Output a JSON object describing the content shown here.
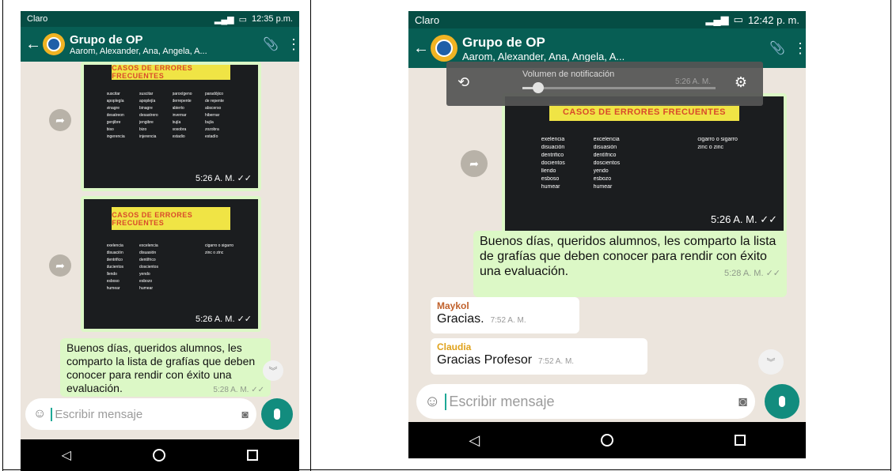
{
  "phones": [
    {
      "status": {
        "carrier": "Claro",
        "time": "12:35 p.m."
      },
      "header": {
        "title": "Grupo de OP",
        "members": "Aarom, Alexander, Ana, Angela, A..."
      },
      "images": [
        {
          "banner": "CASOS DE ERRORES FRECUENTES",
          "words": [
            "suscitar",
            "suscitar",
            "paroxígeno",
            "paradójico",
            "apoplegía",
            "apoplejía",
            "derrepente",
            "de repente",
            "vinagre",
            "binagre",
            "abierto",
            "abscerso",
            "desatreon",
            "desastrero",
            "invernar",
            "hibernar",
            "genjibre",
            "jengibre",
            "bujía",
            "bujía",
            "biso",
            "bizo",
            "sosobra",
            "zozobra",
            "ingerencia",
            "injerencia",
            "estadio",
            "estadío"
          ],
          "time": "5:26 A. M."
        },
        {
          "banner": "CASOS DE ERRORES FRECUENTES",
          "words": [
            "exelencia",
            "excelencia",
            "",
            "cigarro o sigarro",
            "disuación",
            "disuasión",
            "",
            "zinc o zinc",
            "dentrifico",
            "dentífrico",
            "",
            "",
            "ducientos",
            "doscientos",
            "",
            "",
            "llendo",
            "yendo",
            "",
            "",
            "esboso",
            "esbozo",
            "",
            "",
            "humear",
            "humear",
            "",
            ""
          ],
          "time": "5:26 A. M."
        }
      ],
      "message": {
        "text": "Buenos días, queridos alumnos, les comparto la lista de grafías que deben conocer para rendir con éxito una evaluación.",
        "time": "5:28 A. M."
      },
      "input": {
        "placeholder": "Escribir mensaje"
      }
    },
    {
      "status": {
        "carrier": "Claro",
        "time": "12:42 p. m."
      },
      "header": {
        "title": "Grupo de OP",
        "members": "Aarom, Alexander, Ana, Angela, A..."
      },
      "volume": {
        "label": "Volumen de notificación",
        "level": 0.08,
        "ghost_time": "5:26 A. M."
      },
      "image": {
        "banner": "CASOS DE ERRORES FRECUENTES",
        "words": [
          "exelencia",
          "excelencia",
          "",
          "cigarro o sigarro",
          "disuación",
          "disuasión",
          "",
          "zinc o zinc",
          "dentrifico",
          "dentífrico",
          "",
          "",
          "docientos",
          "doscientos",
          "",
          "",
          "llendo",
          "yendo",
          "",
          "",
          "esboso",
          "esbozo",
          "",
          "",
          "humear",
          "humear",
          "",
          ""
        ],
        "time": "5:26 A. M."
      },
      "message": {
        "text": "Buenos días, queridos alumnos, les comparto la lista de grafías que deben conocer para rendir con éxito una evaluación.",
        "time": "5:28 A. M."
      },
      "replies": [
        {
          "sender": "Maykol",
          "text": "Gracias.",
          "time": "7:52 A. M.",
          "color": "#c0612b"
        },
        {
          "sender": "Claudia",
          "text": "Gracias Profesor",
          "time": "7:52 A. M.",
          "color": "#e0a21b"
        }
      ],
      "input": {
        "placeholder": "Escribir mensaje"
      }
    }
  ],
  "colors": {
    "header": "#075e54",
    "outgoing_bubble": "#dcf8c6",
    "incoming_bubble": "#ffffff",
    "mic_button": "#128c7e",
    "chat_background": "#ece5dd"
  },
  "icons": [
    "back-arrow-icon",
    "group-avatar-icon",
    "attachment-icon",
    "overflow-menu-icon",
    "share-icon",
    "read-receipt-icon",
    "emoji-icon",
    "camera-icon",
    "mic-icon",
    "scroll-down-icon",
    "nav-back-icon",
    "nav-home-icon",
    "nav-recent-icon",
    "rotation-lock-icon",
    "settings-gear-icon"
  ]
}
